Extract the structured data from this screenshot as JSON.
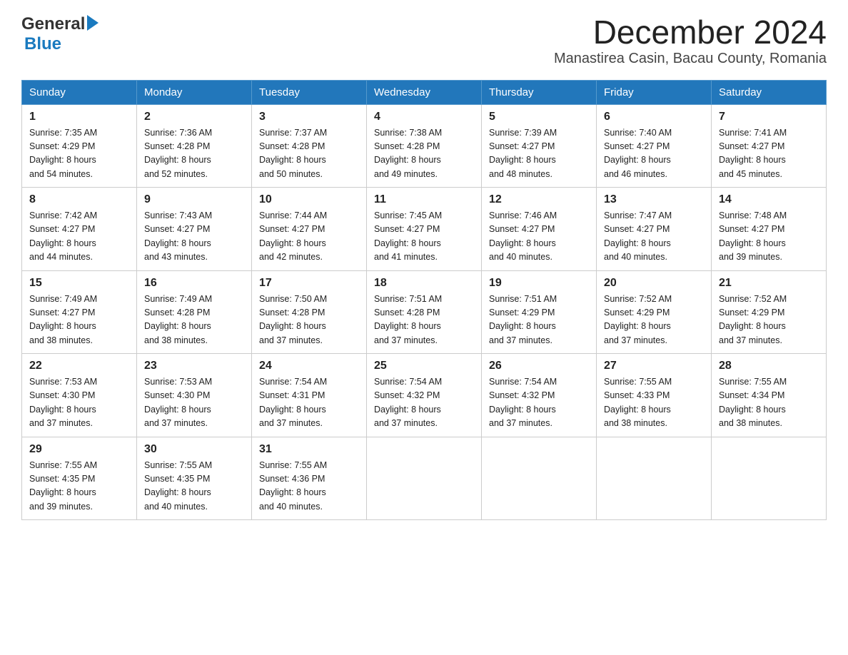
{
  "logo": {
    "word1": "General",
    "word2": "Blue"
  },
  "title": "December 2024",
  "subtitle": "Manastirea Casin, Bacau County, Romania",
  "days_of_week": [
    "Sunday",
    "Monday",
    "Tuesday",
    "Wednesday",
    "Thursday",
    "Friday",
    "Saturday"
  ],
  "weeks": [
    [
      {
        "day": "1",
        "sunrise": "7:35 AM",
        "sunset": "4:29 PM",
        "daylight": "8 hours and 54 minutes."
      },
      {
        "day": "2",
        "sunrise": "7:36 AM",
        "sunset": "4:28 PM",
        "daylight": "8 hours and 52 minutes."
      },
      {
        "day": "3",
        "sunrise": "7:37 AM",
        "sunset": "4:28 PM",
        "daylight": "8 hours and 50 minutes."
      },
      {
        "day": "4",
        "sunrise": "7:38 AM",
        "sunset": "4:28 PM",
        "daylight": "8 hours and 49 minutes."
      },
      {
        "day": "5",
        "sunrise": "7:39 AM",
        "sunset": "4:27 PM",
        "daylight": "8 hours and 48 minutes."
      },
      {
        "day": "6",
        "sunrise": "7:40 AM",
        "sunset": "4:27 PM",
        "daylight": "8 hours and 46 minutes."
      },
      {
        "day": "7",
        "sunrise": "7:41 AM",
        "sunset": "4:27 PM",
        "daylight": "8 hours and 45 minutes."
      }
    ],
    [
      {
        "day": "8",
        "sunrise": "7:42 AM",
        "sunset": "4:27 PM",
        "daylight": "8 hours and 44 minutes."
      },
      {
        "day": "9",
        "sunrise": "7:43 AM",
        "sunset": "4:27 PM",
        "daylight": "8 hours and 43 minutes."
      },
      {
        "day": "10",
        "sunrise": "7:44 AM",
        "sunset": "4:27 PM",
        "daylight": "8 hours and 42 minutes."
      },
      {
        "day": "11",
        "sunrise": "7:45 AM",
        "sunset": "4:27 PM",
        "daylight": "8 hours and 41 minutes."
      },
      {
        "day": "12",
        "sunrise": "7:46 AM",
        "sunset": "4:27 PM",
        "daylight": "8 hours and 40 minutes."
      },
      {
        "day": "13",
        "sunrise": "7:47 AM",
        "sunset": "4:27 PM",
        "daylight": "8 hours and 40 minutes."
      },
      {
        "day": "14",
        "sunrise": "7:48 AM",
        "sunset": "4:27 PM",
        "daylight": "8 hours and 39 minutes."
      }
    ],
    [
      {
        "day": "15",
        "sunrise": "7:49 AM",
        "sunset": "4:27 PM",
        "daylight": "8 hours and 38 minutes."
      },
      {
        "day": "16",
        "sunrise": "7:49 AM",
        "sunset": "4:28 PM",
        "daylight": "8 hours and 38 minutes."
      },
      {
        "day": "17",
        "sunrise": "7:50 AM",
        "sunset": "4:28 PM",
        "daylight": "8 hours and 37 minutes."
      },
      {
        "day": "18",
        "sunrise": "7:51 AM",
        "sunset": "4:28 PM",
        "daylight": "8 hours and 37 minutes."
      },
      {
        "day": "19",
        "sunrise": "7:51 AM",
        "sunset": "4:29 PM",
        "daylight": "8 hours and 37 minutes."
      },
      {
        "day": "20",
        "sunrise": "7:52 AM",
        "sunset": "4:29 PM",
        "daylight": "8 hours and 37 minutes."
      },
      {
        "day": "21",
        "sunrise": "7:52 AM",
        "sunset": "4:29 PM",
        "daylight": "8 hours and 37 minutes."
      }
    ],
    [
      {
        "day": "22",
        "sunrise": "7:53 AM",
        "sunset": "4:30 PM",
        "daylight": "8 hours and 37 minutes."
      },
      {
        "day": "23",
        "sunrise": "7:53 AM",
        "sunset": "4:30 PM",
        "daylight": "8 hours and 37 minutes."
      },
      {
        "day": "24",
        "sunrise": "7:54 AM",
        "sunset": "4:31 PM",
        "daylight": "8 hours and 37 minutes."
      },
      {
        "day": "25",
        "sunrise": "7:54 AM",
        "sunset": "4:32 PM",
        "daylight": "8 hours and 37 minutes."
      },
      {
        "day": "26",
        "sunrise": "7:54 AM",
        "sunset": "4:32 PM",
        "daylight": "8 hours and 37 minutes."
      },
      {
        "day": "27",
        "sunrise": "7:55 AM",
        "sunset": "4:33 PM",
        "daylight": "8 hours and 38 minutes."
      },
      {
        "day": "28",
        "sunrise": "7:55 AM",
        "sunset": "4:34 PM",
        "daylight": "8 hours and 38 minutes."
      }
    ],
    [
      {
        "day": "29",
        "sunrise": "7:55 AM",
        "sunset": "4:35 PM",
        "daylight": "8 hours and 39 minutes."
      },
      {
        "day": "30",
        "sunrise": "7:55 AM",
        "sunset": "4:35 PM",
        "daylight": "8 hours and 40 minutes."
      },
      {
        "day": "31",
        "sunrise": "7:55 AM",
        "sunset": "4:36 PM",
        "daylight": "8 hours and 40 minutes."
      },
      null,
      null,
      null,
      null
    ]
  ],
  "labels": {
    "sunrise": "Sunrise:",
    "sunset": "Sunset:",
    "daylight": "Daylight:"
  }
}
